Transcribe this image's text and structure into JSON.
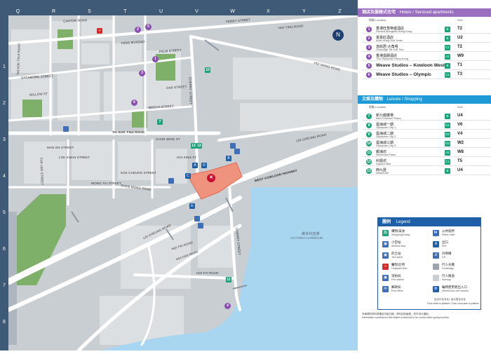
{
  "grid": {
    "columns": [
      "Q",
      "R",
      "S",
      "T",
      "U",
      "V",
      "W",
      "X",
      "Y",
      "Z"
    ],
    "rows": [
      "1",
      "2",
      "3",
      "4",
      "5",
      "6",
      "7",
      "8",
      "9"
    ]
  },
  "map": {
    "north_symbol": "N",
    "streets": [
      {
        "id": "canton-road",
        "text": "CANTON ROAD"
      },
      {
        "id": "ferry-street",
        "text": "FERRY STREET"
      },
      {
        "id": "hoi-ting-road",
        "text": "HOI TING ROAD"
      },
      {
        "id": "hoi-wang-road",
        "text": "HOI WANG ROAD"
      },
      {
        "id": "tong-mi-road",
        "text": "TONG MI ROAD"
      },
      {
        "id": "palm-street",
        "text": "PALM STREET"
      },
      {
        "id": "sycamore-street",
        "text": "SYCAMORE STREET"
      },
      {
        "id": "willow-st",
        "text": "WILLOW ST"
      },
      {
        "id": "oak-street",
        "text": "OAK STREET"
      },
      {
        "id": "cherry-street",
        "text": "CHERRY STREET"
      },
      {
        "id": "beech-street",
        "text": "BEECH STREET"
      },
      {
        "id": "tai-kok-tsui-road",
        "text": "TAI KOK TSUI ROAD"
      },
      {
        "id": "man-on-street",
        "text": "MAN ON STREET"
      },
      {
        "id": "lok-kwan-street",
        "text": "LOK KWAN STREET"
      },
      {
        "id": "fuk-lee-street",
        "text": "FUK LEE STREET"
      },
      {
        "id": "chun-wing-st",
        "text": "CHUN WING ST"
      },
      {
        "id": "hoi-king-st",
        "text": "HOI KING ST"
      },
      {
        "id": "kok-cheung-street",
        "text": "KOK CHEUNG STREET"
      },
      {
        "id": "wong-tai-street",
        "text": "WONG TAI STREET"
      },
      {
        "id": "sham-mong-road",
        "text": "SHAM MONG ROAD"
      },
      {
        "id": "lin-cheung-road-n",
        "text": "LIN CHEUNG ROAD"
      },
      {
        "id": "west-kowloon-hwy",
        "text": "WEST KOWLOON HIGHWAY"
      },
      {
        "id": "lin-cheung-road-s",
        "text": "LIN CHEUNG ROAD"
      },
      {
        "id": "hoi-fai-road-1",
        "text": "HOI FAI ROAD"
      },
      {
        "id": "hoi-fan-road",
        "text": "HOI FAN ROAD"
      },
      {
        "id": "hoi-fai-road-2",
        "text": "HOI FAI ROAD"
      },
      {
        "id": "cherry-street-s",
        "text": "CHERRY STREET"
      },
      {
        "id": "tai-kok-tsui-vert",
        "text": "TAI KOK TSUI ROAD"
      }
    ],
    "harbour_zh": "維多利亞港",
    "harbour_en": "VICTORIA HARBOUR",
    "station_symbol": "✕",
    "pins": [
      "1",
      "2",
      "3",
      "4",
      "5",
      "6",
      "7",
      "8",
      "9",
      "10",
      "11",
      "12",
      "13",
      "14"
    ],
    "exits": [
      "A",
      "B",
      "C",
      "D",
      "E"
    ]
  },
  "hotels": {
    "header_zh": "酒店及服務式住宅",
    "header_en": "Hotels / Serviced apartments",
    "col_location": "地點 Location",
    "col_grid": "Grid",
    "items": [
      {
        "num": "1",
        "zh": "香港旺角帝盛酒店",
        "en": "Dorsett Mongkok,Hong Kong",
        "exit": "B",
        "grid": "T2",
        "color": "#8a4fb0"
      },
      {
        "num": "2",
        "zh": "富豪紅酒店",
        "en": "iclub Mong Kok Hotel",
        "exit": "B",
        "grid": "U2",
        "color": "#8a4fb0"
      },
      {
        "num": "3",
        "zh": "逸凱居-大角咀",
        "en": "Ovolodge Tai Kok Tsui",
        "exit": "C1",
        "grid": "T2",
        "color": "#8a4fb0"
      },
      {
        "num": "4",
        "zh": "香港奧朗酒店",
        "en": "The Olympian Hong Kong",
        "exit": "A2",
        "grid": "W9",
        "color": "#8a4fb0"
      },
      {
        "num": "5",
        "zh": "Weave Studios – Kowloon West",
        "en": "",
        "exit": "B",
        "grid": "T1",
        "color": "#8a4fb0"
      },
      {
        "num": "6",
        "zh": "Weave Studios – Olympic",
        "en": "",
        "exit": "C1",
        "grid": "T3",
        "color": "#8a4fb0"
      }
    ]
  },
  "leisure": {
    "header_zh": "文娛及購物",
    "header_en": "Leisure / Shopping",
    "col_location": "地點 Location",
    "col_grid": "Grid",
    "items": [
      {
        "num": "7",
        "zh": "新九龍廣場",
        "en": "New Kowloon Plaza",
        "exit": "B",
        "grid": "U4",
        "color": "#1aa37a"
      },
      {
        "num": "8",
        "zh": "奧海城一期",
        "en": "Olympian City 1",
        "exit": "D1",
        "grid": "V6",
        "color": "#1aa37a"
      },
      {
        "num": "9",
        "zh": "奧海城二期",
        "en": "Olympian City 2",
        "exit": "D2",
        "grid": "V4",
        "color": "#1aa37a"
      },
      {
        "num": "10",
        "zh": "奧海城三期",
        "en": "Olympian City 3",
        "exit": "D3",
        "grid": "W2",
        "color": "#1aa37a"
      },
      {
        "num": "11",
        "zh": "銀海坊",
        "en": "SilverSea Place",
        "exit": "A2",
        "grid": "W8",
        "color": "#1aa37a"
      },
      {
        "num": "12",
        "zh": "利奧坊",
        "en": "Square Mile",
        "exit": "C1",
        "grid": "T5",
        "color": "#1aa37a"
      },
      {
        "num": "13",
        "zh": "西九匯",
        "en": "WestZone",
        "exit": "B",
        "grid": "U4",
        "color": "#1aa37a"
      }
    ]
  },
  "legend": {
    "title_zh": "圖例",
    "title_en": "Legend",
    "items": [
      {
        "zh": "購物/美食",
        "en": "Shopping/Dining",
        "icon": "🛍",
        "color": "#1aa37a"
      },
      {
        "zh": "公共廁所",
        "en": "Public toilet",
        "icon": "🚻",
        "color": "#3e6fb6"
      },
      {
        "zh": "小巴站",
        "en": "Minibus stop",
        "icon": "▣",
        "color": "#3e6fb6"
      },
      {
        "zh": "出口",
        "en": "Exit",
        "icon": "A",
        "color": "#1f5fa8"
      },
      {
        "zh": "的士站",
        "en": "Taxi stand",
        "icon": "▣",
        "color": "#3e6fb6"
      },
      {
        "zh": "升降機",
        "en": "Lift",
        "icon": "⇵",
        "color": "#3e6fb6"
      },
      {
        "zh": "醫院/診所",
        "en": "Hospital/Clinic",
        "icon": "+",
        "color": "#d62c2c"
      },
      {
        "zh": "行人天橋",
        "en": "Footbridge",
        "icon": "",
        "color": "#9aa5b0"
      },
      {
        "zh": "消防局",
        "en": "Fire station",
        "icon": "▣",
        "color": "#3e6fb6"
      },
      {
        "zh": "行人隧道",
        "en": "Subway",
        "icon": "",
        "color": "#c8ced4"
      },
      {
        "zh": "郵政局",
        "en": "Post office",
        "icon": "✉",
        "color": "#3e6fb6"
      },
      {
        "zh": "輪椅使用者出入口",
        "en": "Wheelchair user access",
        "icon": "♿",
        "color": "#1f5fa8"
      }
    ],
    "wheelchair_note_zh": "由出口往月台 / 由大堂往月台",
    "wheelchair_note_en": "From street to platform / From concourse to platform"
  },
  "footnote_zh": "本單張的資料準確至印製日期，資料如有變更，恕不另行通知。",
  "footnote_en": "Information contained in this leaflet is deemed to be correct when going to press."
}
